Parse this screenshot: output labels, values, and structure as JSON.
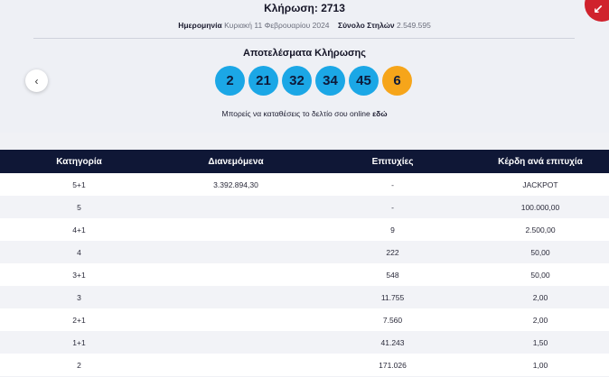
{
  "header": {
    "draw_title": "Κλήρωση: 2713",
    "date_label": "Ημερομηνία",
    "date_value": "Κυριακή 11 Φεβρουαρίου 2024",
    "columns_label": "Σύνολο Στηλών",
    "columns_value": "2.549.595"
  },
  "results": {
    "title": "Αποτελέσματα Κλήρωσης",
    "numbers": [
      "2",
      "21",
      "32",
      "34",
      "45"
    ],
    "bonus": "6",
    "main_color": "#1ba7e6",
    "bonus_color": "#f6a51a"
  },
  "nav": {
    "prev_icon": "‹"
  },
  "online": {
    "text": "Μπορείς να καταθέσεις το δελτίο σου online",
    "link": "εδώ"
  },
  "badge": {
    "icon": "↙",
    "color": "#d0222d"
  },
  "table": {
    "headers": [
      "Κατηγορία",
      "Διανεμόμενα",
      "Επιτυχίες",
      "Κέρδη ανά επιτυχία"
    ],
    "rows": [
      [
        "5+1",
        "3.392.894,30",
        "-",
        "JACKPOT"
      ],
      [
        "5",
        "",
        "-",
        "100.000,00"
      ],
      [
        "4+1",
        "",
        "9",
        "2.500,00"
      ],
      [
        "4",
        "",
        "222",
        "50,00"
      ],
      [
        "3+1",
        "",
        "548",
        "50,00"
      ],
      [
        "3",
        "",
        "11.755",
        "2,00"
      ],
      [
        "2+1",
        "",
        "7.560",
        "2,00"
      ],
      [
        "1+1",
        "",
        "41.243",
        "1,50"
      ],
      [
        "2",
        "",
        "171.026",
        "1,00"
      ]
    ]
  }
}
